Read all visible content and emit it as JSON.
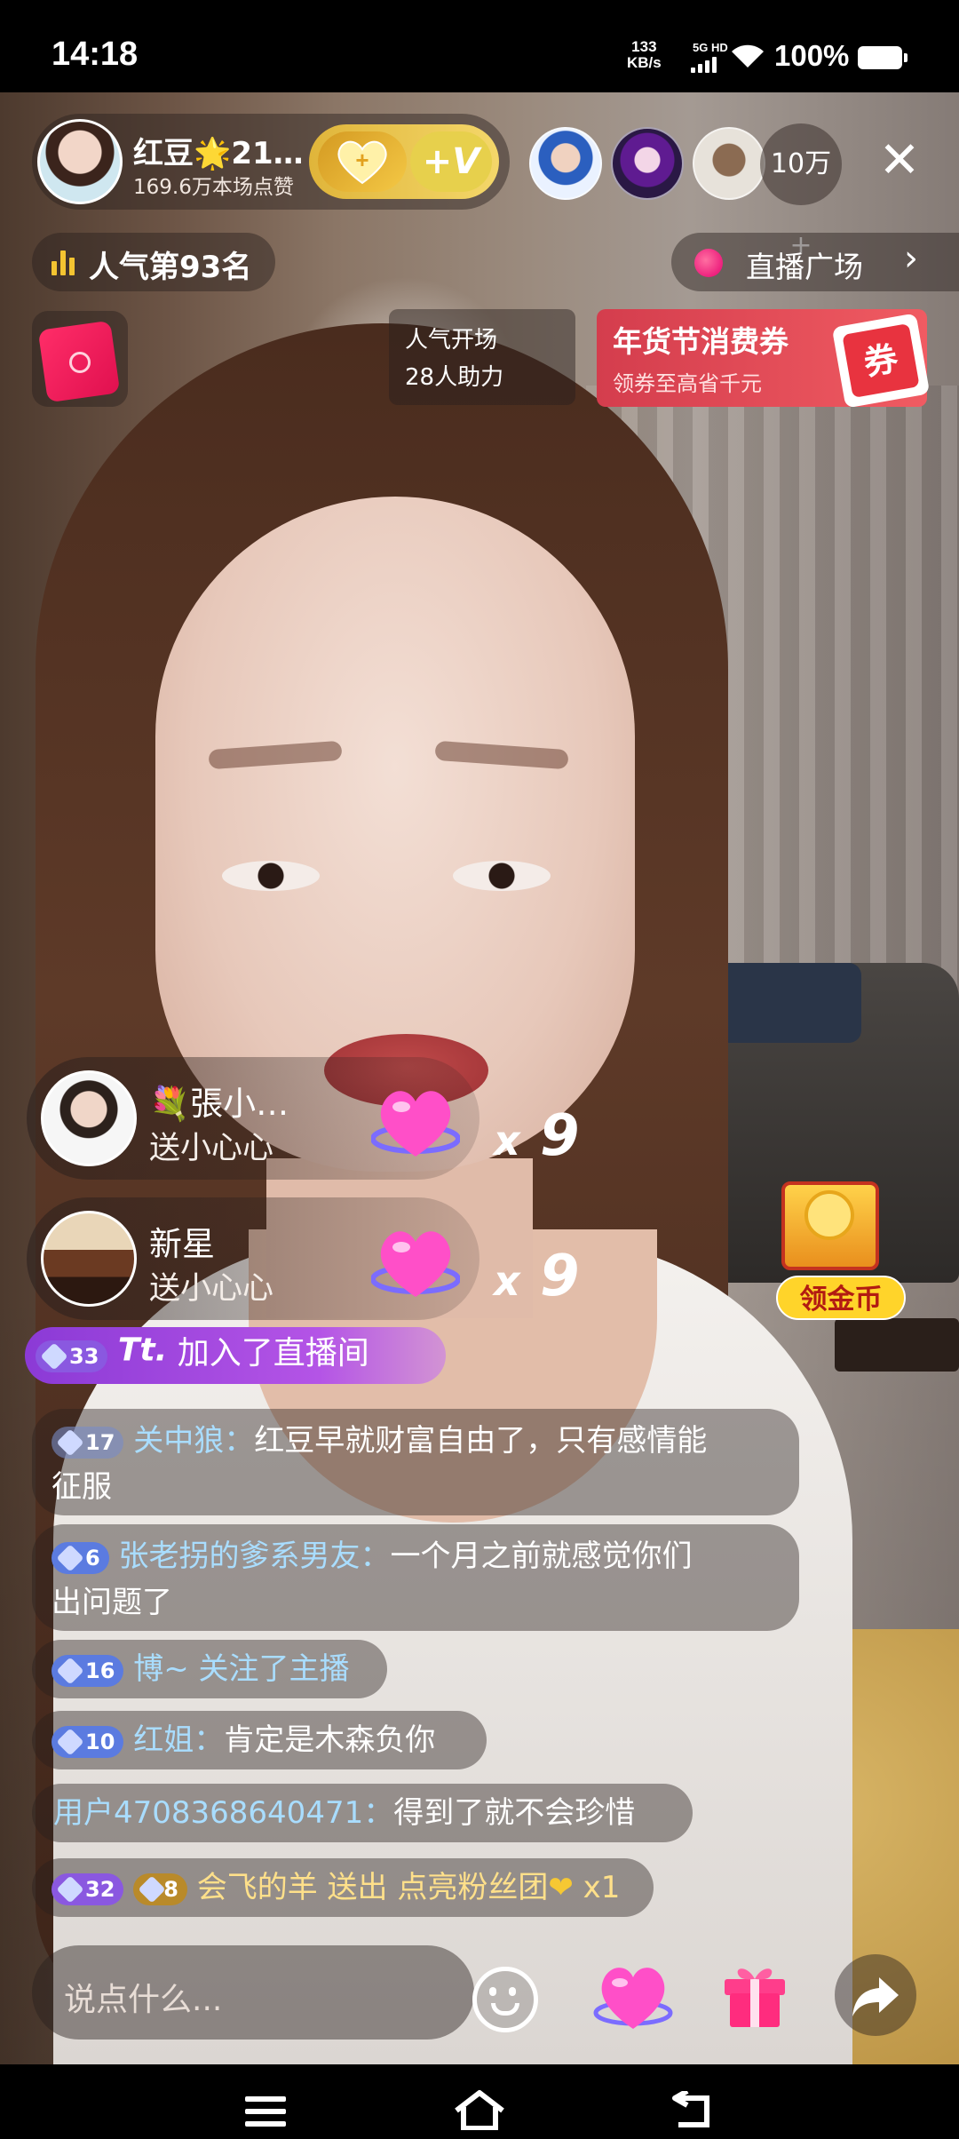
{
  "status_bar": {
    "time": "14:18",
    "net_speed_value": "133",
    "net_speed_unit": "KB/s",
    "signal_label": "5G HD",
    "battery": "100%"
  },
  "host": {
    "name": "红豆🌟21…",
    "likes": "169.6万本场点赞",
    "heart_badge_icon": "heart-plus-icon",
    "v_badge": "+V"
  },
  "viewers": {
    "count": "10万+"
  },
  "rank": {
    "label": "人气第93名"
  },
  "live_square": {
    "label": "直播广场"
  },
  "popularity": {
    "line1": "人气开场",
    "line2": "28人助力"
  },
  "coupon": {
    "title": "年货节消费券",
    "subtitle": "领券至高省千元",
    "tag": "券"
  },
  "gifts": [
    {
      "name": "💐張小…",
      "action": "送小心心",
      "x": "x",
      "count": "9"
    },
    {
      "name": "新星",
      "action": "送小心心",
      "x": "x",
      "count": "9"
    }
  ],
  "join_message": {
    "level": "33",
    "user": "Tt.",
    "text": " 加入了直播间"
  },
  "chat": [
    {
      "level": "17",
      "user": "关中狼：",
      "line1": "红豆早就财富自由了，只有感情能",
      "line2": "征服"
    },
    {
      "level": "6",
      "user": "张老拐的爹系男友：",
      "line1": "一个月之前就感觉你们",
      "line2": "出问题了"
    },
    {
      "level": "16",
      "user": "博~ 关注了主播"
    },
    {
      "level": "10",
      "user": "红姐：",
      "text": "肯定是木森负你"
    },
    {
      "user": "用户4708368640471：",
      "text": "得到了就不会珍惜"
    },
    {
      "level": "32",
      "fan_badge": "8",
      "user": "会飞的羊",
      "action": " 送出 ",
      "gift": "点亮粉丝团",
      "count": " x1"
    }
  ],
  "coin_reward": {
    "label": "领金币"
  },
  "input": {
    "placeholder": "说点什么..."
  },
  "icons": {
    "emoji": "emoji-icon",
    "heart": "heart-icon",
    "gift": "gift-icon",
    "share": "share-icon",
    "close": "close-icon"
  },
  "close_glyph": "✕",
  "square_chevron": "›"
}
